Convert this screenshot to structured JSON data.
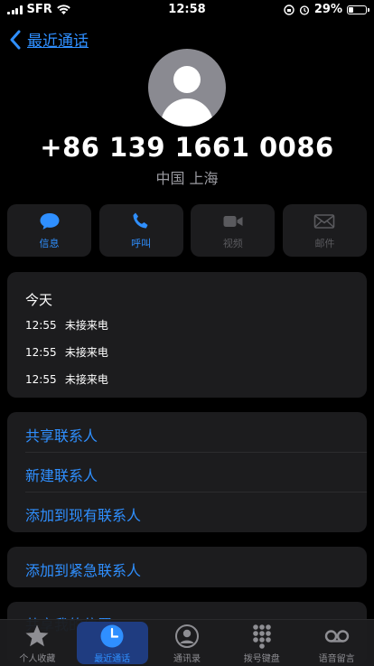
{
  "status": {
    "carrier": "SFR",
    "time": "12:58",
    "battery": "29%",
    "battery_level": 0.29
  },
  "nav": {
    "back_label": "最近通话"
  },
  "contact": {
    "number": "+86 139 1661 0086",
    "location": "中国 上海"
  },
  "actions": [
    {
      "label": "信息",
      "icon": "message-icon",
      "enabled": true
    },
    {
      "label": "呼叫",
      "icon": "phone-icon",
      "enabled": true
    },
    {
      "label": "视频",
      "icon": "video-icon",
      "enabled": false
    },
    {
      "label": "邮件",
      "icon": "mail-icon",
      "enabled": false
    }
  ],
  "history": {
    "day": "今天",
    "entries": [
      {
        "time": "12:55",
        "type": "未接来电"
      },
      {
        "time": "12:55",
        "type": "未接来电"
      },
      {
        "time": "12:55",
        "type": "未接来电"
      }
    ]
  },
  "options": {
    "share_contact": "共享联系人",
    "new_contact": "新建联系人",
    "add_existing": "添加到现有联系人",
    "add_emergency": "添加到紧急联系人",
    "share_location": "共享我的位置"
  },
  "tabs": [
    {
      "label": "个人收藏",
      "icon": "star-icon"
    },
    {
      "label": "最近通话",
      "icon": "clock-icon",
      "active": true
    },
    {
      "label": "通讯录",
      "icon": "contacts-icon"
    },
    {
      "label": "拨号键盘",
      "icon": "keypad-icon"
    },
    {
      "label": "语音留言",
      "icon": "voicemail-icon"
    }
  ],
  "colors": {
    "accent": "#2f8fff",
    "card": "#1c1c1e",
    "background": "#000000"
  }
}
